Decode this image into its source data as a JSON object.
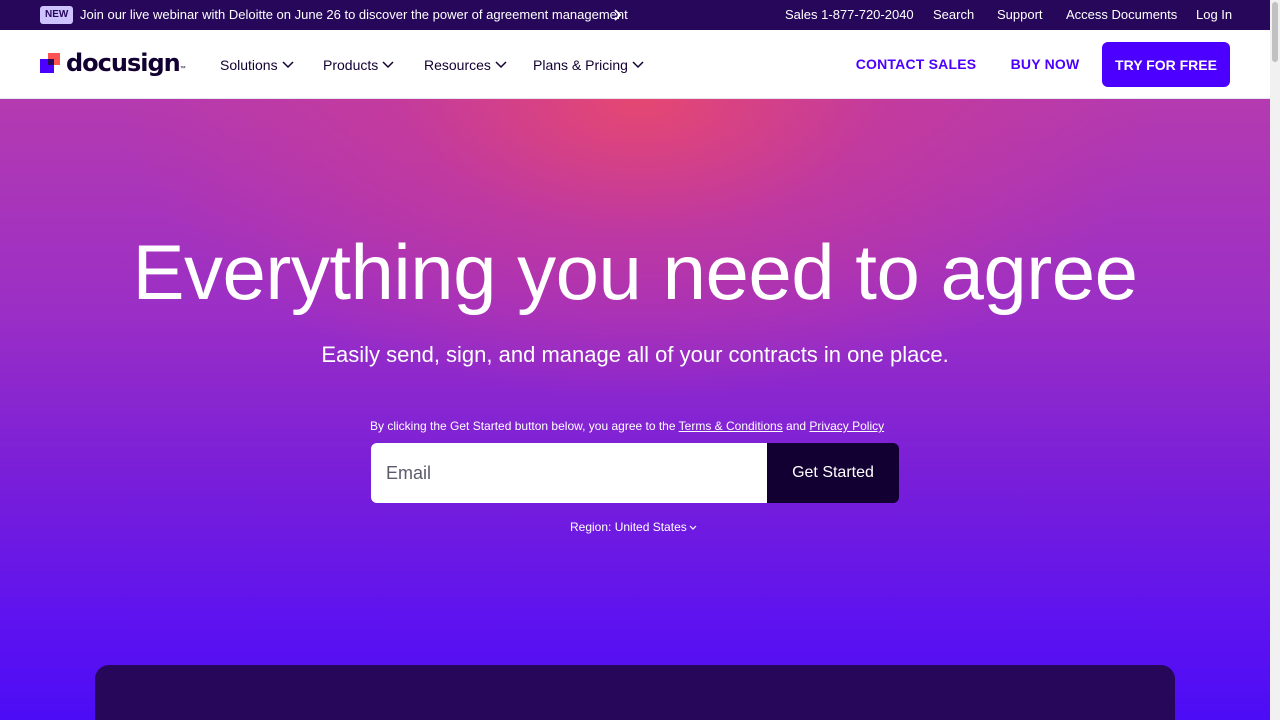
{
  "topbar": {
    "badge": "NEW",
    "promo_text": "Join our live webinar with Deloitte on June 26 to discover the power of agreement management",
    "promo_arrow_icon": "chevron-right-icon",
    "links": {
      "sales": "Sales 1-877-720-2040",
      "search": "Search",
      "support": "Support",
      "access_documents": "Access Documents",
      "login": "Log In"
    },
    "colors": {
      "background": "#26075a",
      "badge_bg": "#cfc3ff"
    }
  },
  "header": {
    "logo_text": "docusign",
    "logo_tm": "™",
    "nav": {
      "solutions": "Solutions",
      "products": "Products",
      "resources": "Resources",
      "plans_pricing": "Plans & Pricing"
    },
    "buttons": {
      "contact_sales": "CONTACT SALES",
      "buy_now": "BUY NOW",
      "try_free": "TRY FOR FREE"
    },
    "colors": {
      "brand": "#4c00ff",
      "text": "#130032"
    }
  },
  "hero": {
    "title": "Everything you need to agree",
    "subtitle": "Easily send, sign, and manage all of your contracts in one place.",
    "consent_prefix": "By clicking the Get Started button below, you agree to the",
    "terms_link": "Terms & Conditions",
    "consent_and": "and",
    "privacy_link": "Privacy Policy",
    "email_placeholder": "Email",
    "cta": "Get Started",
    "region": "Region: United States",
    "colors": {
      "cta_bg": "#130032",
      "panel_bg": "#26075a"
    }
  }
}
